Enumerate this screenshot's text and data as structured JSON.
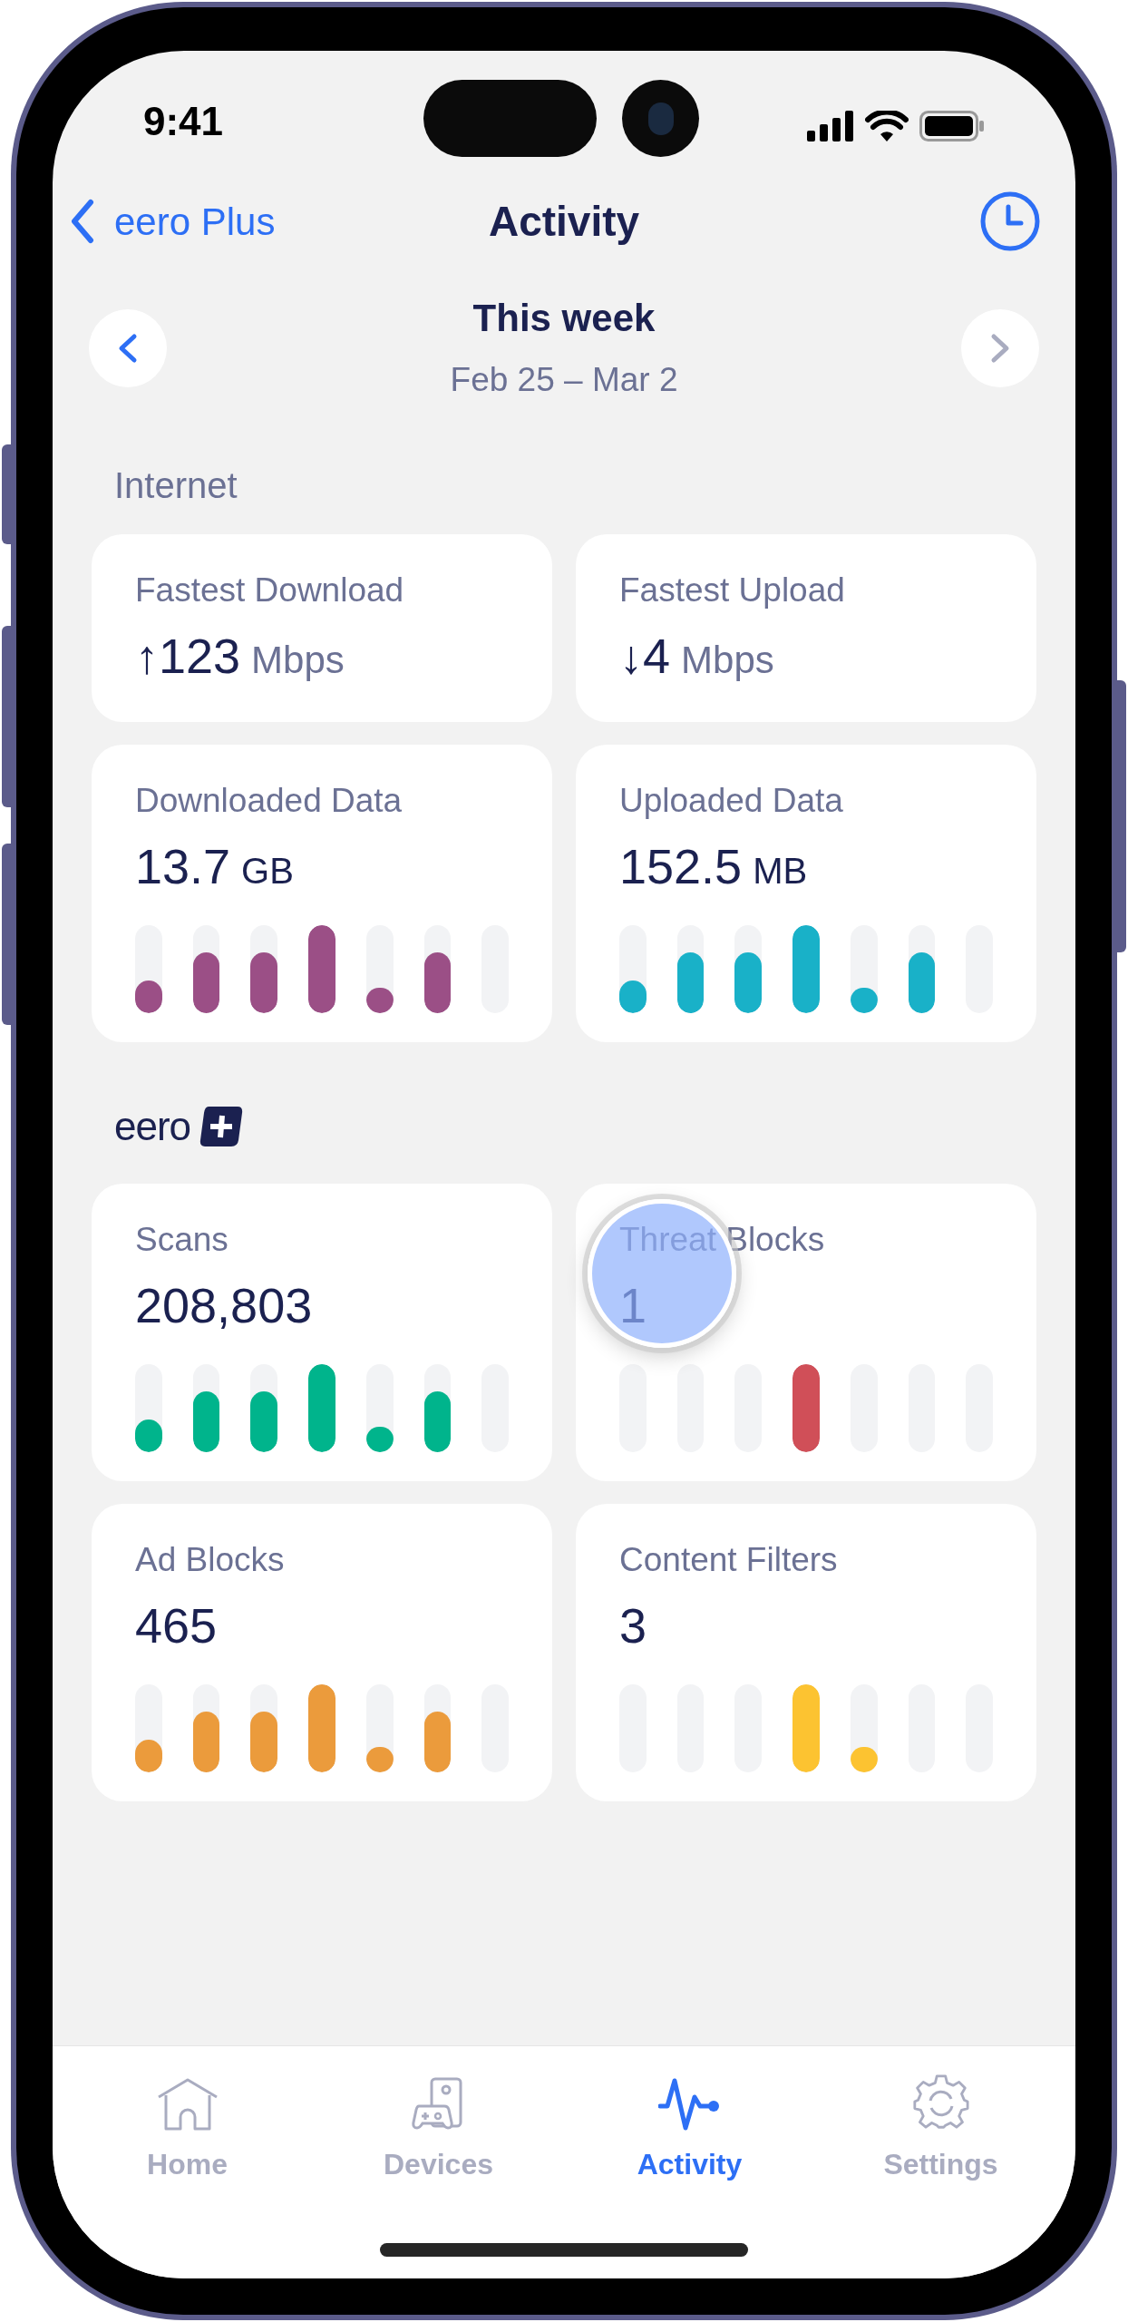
{
  "status_bar": {
    "time": "9:41"
  },
  "nav": {
    "back": "eero Plus",
    "title": "Activity"
  },
  "period": {
    "title": "This week",
    "range": "Feb 25 – Mar 2",
    "prev": {
      "disabled": false
    },
    "next": {
      "disabled": true
    }
  },
  "sections": [
    {
      "kind": "heading",
      "title": "Internet",
      "cards": [
        {
          "kind": "speed",
          "label": "Fastest Download",
          "arrow": "↑",
          "value": "123",
          "unit": "Mbps"
        },
        {
          "kind": "speed",
          "label": "Fastest Upload",
          "arrow": "↓",
          "value": "4",
          "unit": "Mbps"
        },
        {
          "kind": "usage",
          "label": "Downloaded Data",
          "value": "13.7",
          "unit": "GB",
          "color": "#9b4f86",
          "bars": [
            {
              "level": 0.37
            },
            {
              "level": 0.69
            },
            {
              "level": 0.69
            },
            {
              "level": 1
            },
            {
              "level": 0.29
            },
            {
              "level": 0.69
            },
            {
              "level": 0
            }
          ]
        },
        {
          "kind": "usage",
          "label": "Uploaded Data",
          "value": "152.5",
          "unit": "MB",
          "color": "#19b1c8",
          "bars": [
            {
              "level": 0.37
            },
            {
              "level": 0.69
            },
            {
              "level": 0.69
            },
            {
              "level": 1
            },
            {
              "level": 0.29
            },
            {
              "level": 0.69
            },
            {
              "level": 0
            }
          ]
        }
      ]
    },
    {
      "kind": "logo",
      "title": "eero",
      "cards": [
        {
          "kind": "count",
          "label": "Scans",
          "value": "208,803",
          "color": "#00b48c",
          "bars": [
            {
              "level": 0.37
            },
            {
              "level": 0.69
            },
            {
              "level": 0.69
            },
            {
              "level": 1
            },
            {
              "level": 0.29
            },
            {
              "level": 0.69
            },
            {
              "level": 0
            }
          ]
        },
        {
          "kind": "count",
          "label": "Threat Blocks",
          "value": "1",
          "color": "#d04f58",
          "bars": [
            {
              "level": 0
            },
            {
              "level": 0
            },
            {
              "level": 0
            },
            {
              "level": 1
            },
            {
              "level": 0
            },
            {
              "level": 0
            },
            {
              "level": 0
            }
          ]
        },
        {
          "kind": "count",
          "label": "Ad Blocks",
          "value": "465",
          "color": "#eb9b3c",
          "bars": [
            {
              "level": 0.37
            },
            {
              "level": 0.69
            },
            {
              "level": 0.69
            },
            {
              "level": 1
            },
            {
              "level": 0.29
            },
            {
              "level": 0.69
            },
            {
              "level": 0
            }
          ]
        },
        {
          "kind": "count",
          "label": "Content Filters",
          "value": "3",
          "color": "#fcc331",
          "bars": [
            {
              "level": 0
            },
            {
              "level": 0
            },
            {
              "level": 0
            },
            {
              "level": 1
            },
            {
              "level": 0.29
            },
            {
              "level": 0
            },
            {
              "level": 0
            }
          ]
        }
      ]
    }
  ],
  "tabs": [
    {
      "label": "Home",
      "selected": false
    },
    {
      "label": "Devices",
      "selected": false
    },
    {
      "label": "Activity",
      "selected": true
    },
    {
      "label": "Settings",
      "selected": false
    }
  ]
}
